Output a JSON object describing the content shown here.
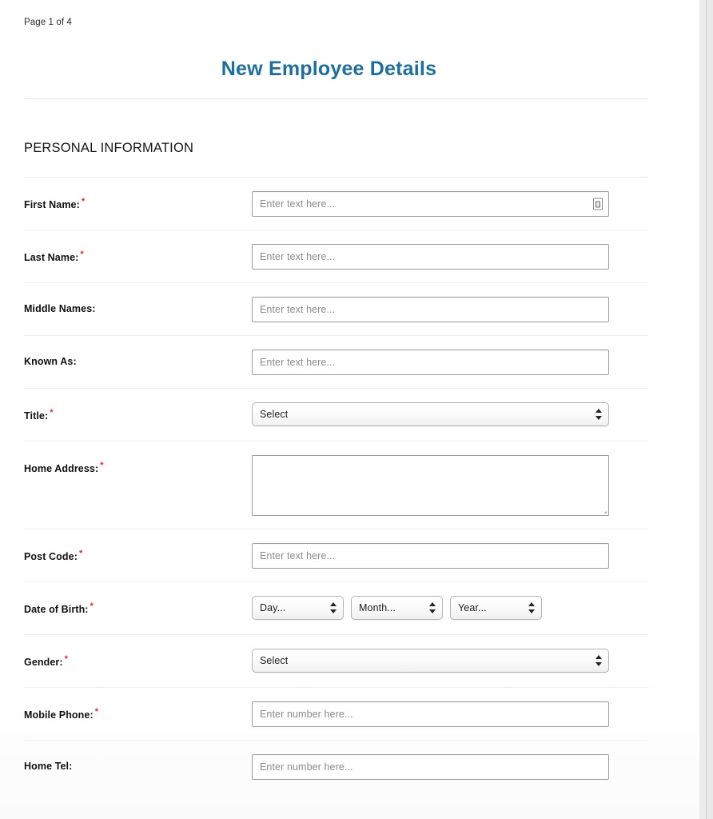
{
  "header": {
    "page_counter": "Page 1 of 4",
    "title": "New Employee Details",
    "title_color": "#1a6f9e"
  },
  "section": {
    "heading": "PERSONAL INFORMATION"
  },
  "required_marker": "*",
  "fields": [
    {
      "label": "First Name:",
      "required": true,
      "type": "text",
      "placeholder": "Enter text here...",
      "value": "",
      "icon": "autofill-contact-card-icon"
    },
    {
      "label": "Last Name:",
      "required": true,
      "type": "text",
      "placeholder": "Enter text here...",
      "value": ""
    },
    {
      "label": "Middle Names:",
      "required": false,
      "type": "text",
      "placeholder": "Enter text here...",
      "value": ""
    },
    {
      "label": "Known As:",
      "required": false,
      "type": "text",
      "placeholder": "Enter text here...",
      "value": ""
    },
    {
      "label": "Title:",
      "required": true,
      "type": "select",
      "selected": "Select"
    },
    {
      "label": "Home Address:",
      "required": true,
      "type": "textarea",
      "placeholder": "",
      "value": ""
    },
    {
      "label": "Post Code:",
      "required": true,
      "type": "text",
      "placeholder": "Enter text here...",
      "value": ""
    },
    {
      "label": "Date of Birth:",
      "required": true,
      "type": "date-group",
      "parts": [
        {
          "selected": "Day..."
        },
        {
          "selected": "Month..."
        },
        {
          "selected": "Year..."
        }
      ]
    },
    {
      "label": "Gender:",
      "required": true,
      "type": "select",
      "selected": "Select"
    },
    {
      "label": "Mobile Phone:",
      "required": true,
      "type": "text",
      "placeholder": "Enter number here...",
      "value": ""
    },
    {
      "label": "Home Tel:",
      "required": false,
      "type": "text",
      "placeholder": "Enter number here...",
      "value": ""
    }
  ]
}
